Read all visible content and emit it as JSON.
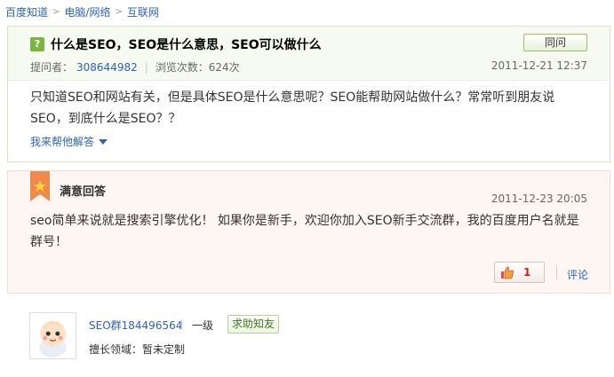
{
  "breadcrumb": {
    "items": [
      "百度知道",
      "电脑/网络",
      "互联网"
    ],
    "separator": ">"
  },
  "question": {
    "icon": "question-mark-icon",
    "title": "什么是SEO，SEO是什么意思，SEO可以做什么",
    "same_button": "同问",
    "asker_label": "提问者：",
    "asker": "308644982",
    "views_label": "浏览次数：624次",
    "time": "2011-12-21 12:37",
    "body": "只知道SEO和网站有关，但是具体SEO是什么意思呢？SEO能帮助网站做什么？常常听到朋友说SEO，到底什么是SEO？？",
    "help_link": "我来帮他解答"
  },
  "answer": {
    "badge_icon": "ribbon-badge-icon",
    "title": "满意回答",
    "time": "2011-12-23 20:05",
    "body": "seo简单来说就是搜索引擎优化！ 如果你是新手，欢迎你加入SEO新手交流群，我的百度用户名就是群号！",
    "like_icon": "thumbs-up-icon",
    "like_count": "1",
    "comment_link": "评论"
  },
  "answerer": {
    "avatar_icon": "baby-avatar-icon",
    "name": "SEO群184496564",
    "level": "一级",
    "ask_button": "求助知友",
    "expertise_label": "擅长领域：",
    "expertise": "暂未定制"
  },
  "colors": {
    "link": "#2d64b3",
    "question_bg": "#f6faf0",
    "answer_bg": "#fdf6f3",
    "like_count": "#c0281d"
  }
}
